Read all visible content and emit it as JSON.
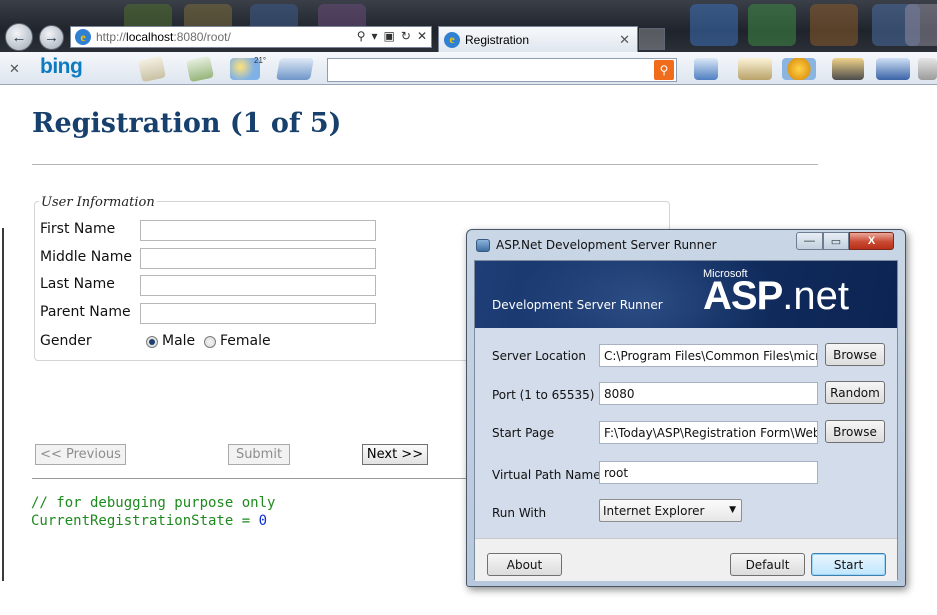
{
  "browser": {
    "address": {
      "prefix": "http://",
      "host": "localhost",
      "rest": ":8080/root/"
    },
    "tab_title": "Registration",
    "weather_temp": "21°",
    "toolbar_brand": "bing",
    "search_value": ""
  },
  "page": {
    "title": "Registration (1 of 5)",
    "fieldset_legend": "User Information",
    "labels": {
      "first_name": "First Name",
      "middle_name": "Middle Name",
      "last_name": "Last Name",
      "parent_name": "Parent Name",
      "gender": "Gender"
    },
    "values": {
      "first_name": "",
      "middle_name": "",
      "last_name": "",
      "parent_name": ""
    },
    "gender_options": {
      "male": "Male",
      "female": "Female",
      "selected": "male"
    },
    "buttons": {
      "previous": "<< Previous",
      "submit": "Submit",
      "next": "Next >>"
    },
    "debug": {
      "comment": "// for debugging purpose only",
      "state_name": "CurrentRegistrationState",
      "state_eq": " = ",
      "state_value": "0"
    }
  },
  "dialog": {
    "title": "ASP.Net Development Server Runner",
    "window_buttons": {
      "minimize": "—",
      "maximize": "▭",
      "close": "X"
    },
    "banner": {
      "subtitle": "Development Server Runner",
      "microsoft": "Microsoft",
      "logo_asp": "ASP",
      "logo_net": ".net"
    },
    "fields": {
      "server_location_label": "Server Location",
      "server_location_value": "C:\\Program Files\\Common Files\\microsoft",
      "port_label": "Port (1 to 65535)",
      "port_value": "8080",
      "start_page_label": "Start Page",
      "start_page_value": "F:\\Today\\ASP\\Registration Form\\WebApp",
      "virtual_path_label": "Virtual Path Name",
      "virtual_path_value": "root",
      "run_with_label": "Run With",
      "run_with_value": "Internet Explorer"
    },
    "buttons": {
      "browse": "Browse",
      "random": "Random",
      "about": "About",
      "default": "Default",
      "start": "Start"
    }
  },
  "colors": {
    "title": "#17406d",
    "banner": "#122f63",
    "code_green": "#1e8a1e",
    "code_blue": "#0f2dd0"
  }
}
